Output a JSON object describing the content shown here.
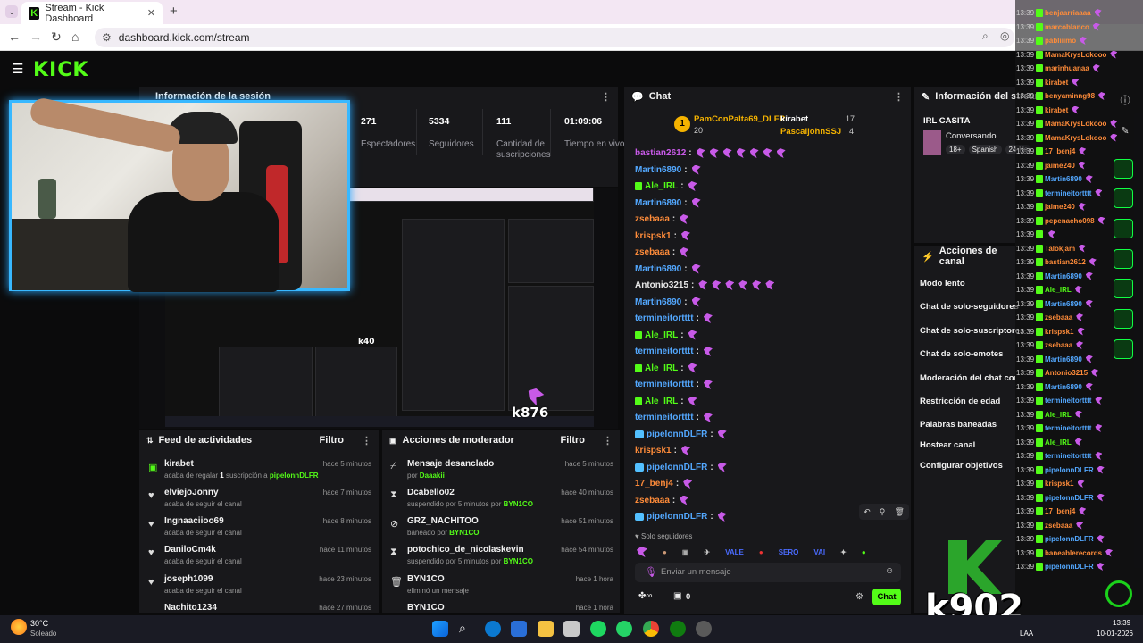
{
  "browser": {
    "tab_title": "Stream - Kick Dashboard",
    "url": "dashboard.kick.com/stream"
  },
  "session": {
    "title": "Información de la sesión",
    "stats": [
      {
        "value": "271",
        "label": "Espectadores"
      },
      {
        "value": "5334",
        "label": "Seguidores"
      },
      {
        "value": "111",
        "label": "Cantidad de suscripciones"
      },
      {
        "value": "01:09:06",
        "label": "Tiempo en vivo"
      }
    ]
  },
  "chat": {
    "title": "Chat",
    "top_gifter_1": "PamConPalta69_DLFR",
    "top_gifter_1_count": "20",
    "top_gifter_2": "kirabet",
    "top_gifter_2_count": "17",
    "top_gifter_3": "PascaljohnSSJ",
    "top_gifter_3_count": "4",
    "messages": [
      {
        "user": "bastian2612",
        "color": "#c85ae8",
        "emotes": 7
      },
      {
        "user": "Martin6890",
        "color": "#53a8ff",
        "emotes": 1
      },
      {
        "user": "Ale_IRL",
        "color": "#53fc18",
        "emotes": 1
      },
      {
        "user": "Martin6890",
        "color": "#53a8ff",
        "emotes": 1
      },
      {
        "user": "zsebaaa",
        "color": "#ff8c3a",
        "emotes": 1
      },
      {
        "user": "krispsk1",
        "color": "#ff8c3a",
        "emotes": 1
      },
      {
        "user": "zsebaaa",
        "color": "#ff8c3a",
        "emotes": 1
      },
      {
        "user": "Martin6890",
        "color": "#53a8ff",
        "emotes": 1
      },
      {
        "user": "Antonio3215",
        "color": "#e8e8e8",
        "emotes": 6
      },
      {
        "user": "Martin6890",
        "color": "#53a8ff",
        "emotes": 1
      },
      {
        "user": "termineitortttt",
        "color": "#53a8ff",
        "emotes": 1
      },
      {
        "user": "Ale_IRL",
        "color": "#53fc18",
        "emotes": 1
      },
      {
        "user": "termineitortttt",
        "color": "#53a8ff",
        "emotes": 1
      },
      {
        "user": "Ale_IRL",
        "color": "#53fc18",
        "emotes": 1
      },
      {
        "user": "termineitortttt",
        "color": "#53a8ff",
        "emotes": 1
      },
      {
        "user": "Ale_IRL",
        "color": "#53fc18",
        "emotes": 1
      },
      {
        "user": "termineitortttt",
        "color": "#53a8ff",
        "emotes": 1
      },
      {
        "user": "pipelonnDLFR",
        "color": "#53a8ff",
        "emotes": 1
      },
      {
        "user": "krispsk1",
        "color": "#ff8c3a",
        "emotes": 1
      },
      {
        "user": "pipelonnDLFR",
        "color": "#53a8ff",
        "emotes": 1
      },
      {
        "user": "17_benj4",
        "color": "#ff8c3a",
        "emotes": 1
      },
      {
        "user": "zsebaaa",
        "color": "#ff8c3a",
        "emotes": 1
      },
      {
        "user": "pipelonnDLFR",
        "color": "#53a8ff",
        "emotes": 1
      }
    ],
    "followers_only": "Solo seguidores",
    "emote_row": [
      "VALE",
      "SERO",
      "VAI"
    ],
    "input_placeholder": "Enviar un mensaje",
    "points": "0",
    "send_label": "Chat"
  },
  "stream_info": {
    "title": "Información del stream",
    "stream_title": "IRL CASITA",
    "category": "Conversando",
    "tags": [
      "18+",
      "Spanish",
      "24-Hs"
    ]
  },
  "channel_actions": {
    "title": "Acciones de canal",
    "items": [
      "Modo lento",
      "Chat de solo-seguidores",
      "Chat de solo-suscriptores",
      "Chat de solo-emotes",
      "Moderación del chat con IA",
      "Restricción de edad",
      "Palabras baneadas",
      "Hostear canal",
      "Configurar objetivos"
    ]
  },
  "activity_feed": {
    "title": "Feed de actividades",
    "filter": "Filtro",
    "items": [
      {
        "user": "kirabet",
        "pre": "acaba de regalar ",
        "count": "1",
        "mid": " suscripción a ",
        "target": "pipelonnDLFR",
        "time": "hace 5 minutos",
        "icon": "gift-icon"
      },
      {
        "user": "elviejoJonny",
        "sub": "acaba de seguir el canal",
        "time": "hace 7 minutos",
        "icon": "heart-icon"
      },
      {
        "user": "Ingnaaciioo69",
        "sub": "acaba de seguir el canal",
        "time": "hace 8 minutos",
        "icon": "heart-icon"
      },
      {
        "user": "DaniloCm4k",
        "sub": "acaba de seguir el canal",
        "time": "hace 11 minutos",
        "icon": "heart-icon"
      },
      {
        "user": "joseph1099",
        "sub": "acaba de seguir el canal",
        "time": "hace 23 minutos",
        "icon": "heart-icon"
      },
      {
        "user": "Nachito1234",
        "sub": "",
        "time": "hace 27 minutos",
        "icon": "heart-icon"
      }
    ]
  },
  "mod_actions": {
    "title": "Acciones de moderador",
    "filter": "Filtro",
    "items": [
      {
        "title": "Mensaje desanclado",
        "pre": "por ",
        "actor": "Daaakii",
        "time": "hace 5 minutos",
        "icon": "unpin-icon"
      },
      {
        "title": "Dcabello02",
        "pre": "suspendido por 5 minutos por ",
        "actor": "BYN1CO",
        "time": "hace 40 minutos",
        "icon": "hourglass-icon"
      },
      {
        "title": "GRZ_NACHITOO",
        "pre": "baneado por ",
        "actor": "BYN1CO",
        "time": "hace 51 minutos",
        "icon": "ban-icon"
      },
      {
        "title": "potochico_de_nicolaskevin",
        "pre": "suspendido por 5 minutos por ",
        "actor": "BYN1CO",
        "time": "hace 54 minutos",
        "icon": "hourglass-icon"
      },
      {
        "title": "BYN1CO",
        "pre": "eliminó un mensaje",
        "actor": "",
        "time": "hace 1 hora",
        "icon": "trash-icon"
      },
      {
        "title": "BYN1CO",
        "pre": "",
        "actor": "",
        "time": "hace 1 hora",
        "icon": "trash-icon"
      }
    ]
  },
  "overlay_chat": [
    "benjaarriaaaa",
    "marcoblanco",
    "pabliiimo",
    "MamaKrysLokooo",
    "marinhuanaa",
    "kirabet",
    "benyaminng98",
    "kirabet",
    "MamaKrysLokooo",
    "MamaKrysLokooo",
    "17_benj4",
    "jaime240",
    "Martin6890",
    "termineitortttt",
    "jaime240",
    "pepenacho098",
    "",
    "Talokjam",
    "bastian2612",
    "Martin6890",
    "Ale_IRL",
    "Martin6890",
    "zsebaaa",
    "krispsk1",
    "zsebaaa",
    "Martin6890",
    "Antonio3215",
    "Martin6890",
    "termineitortttt",
    "Ale_IRL",
    "termineitortttt",
    "Ale_IRL",
    "termineitortttt",
    "pipelonnDLFR",
    "krispsk1",
    "pipelonnDLFR",
    "17_benj4",
    "zsebaaa",
    "pipelonnDLFR",
    "baneablerecords",
    "pipelonnDLFR"
  ],
  "overlay_time": "13:39",
  "overlay_k_count": "k902",
  "mirror_k_count": "k876",
  "mirror_k_count_small": "k40",
  "weather": {
    "temp": "30°C",
    "desc": "Soleado"
  },
  "tray": {
    "lang": "LAA",
    "time": "13:39",
    "date": "10-01-2026"
  }
}
